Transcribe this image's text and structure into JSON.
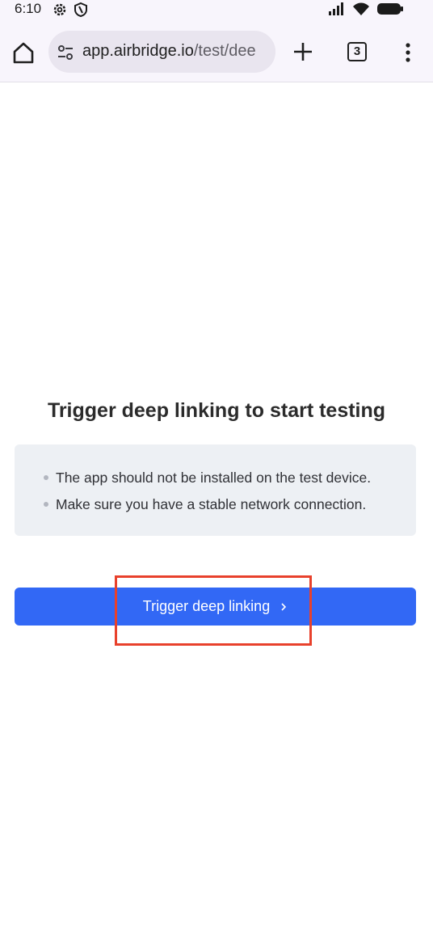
{
  "status_bar": {
    "time": "6:10",
    "left_icons": [
      "gear-icon",
      "shield-icon"
    ],
    "right_icons": [
      "signal-icon",
      "wifi-icon",
      "battery-icon"
    ]
  },
  "browser": {
    "url_host": "app.airbridge.io",
    "url_path": "/test/dee",
    "tab_count": "3",
    "icons": [
      "home-icon",
      "tune-icon",
      "plus-icon",
      "more-vert-icon"
    ]
  },
  "page": {
    "title": "Trigger deep linking to start testing",
    "notices": [
      "The app should not be installed on the test device.",
      "Make sure you have a stable network connection."
    ],
    "button_label": "Trigger deep linking",
    "button_color": "#3268f5",
    "highlight_color": "#e8412c"
  }
}
